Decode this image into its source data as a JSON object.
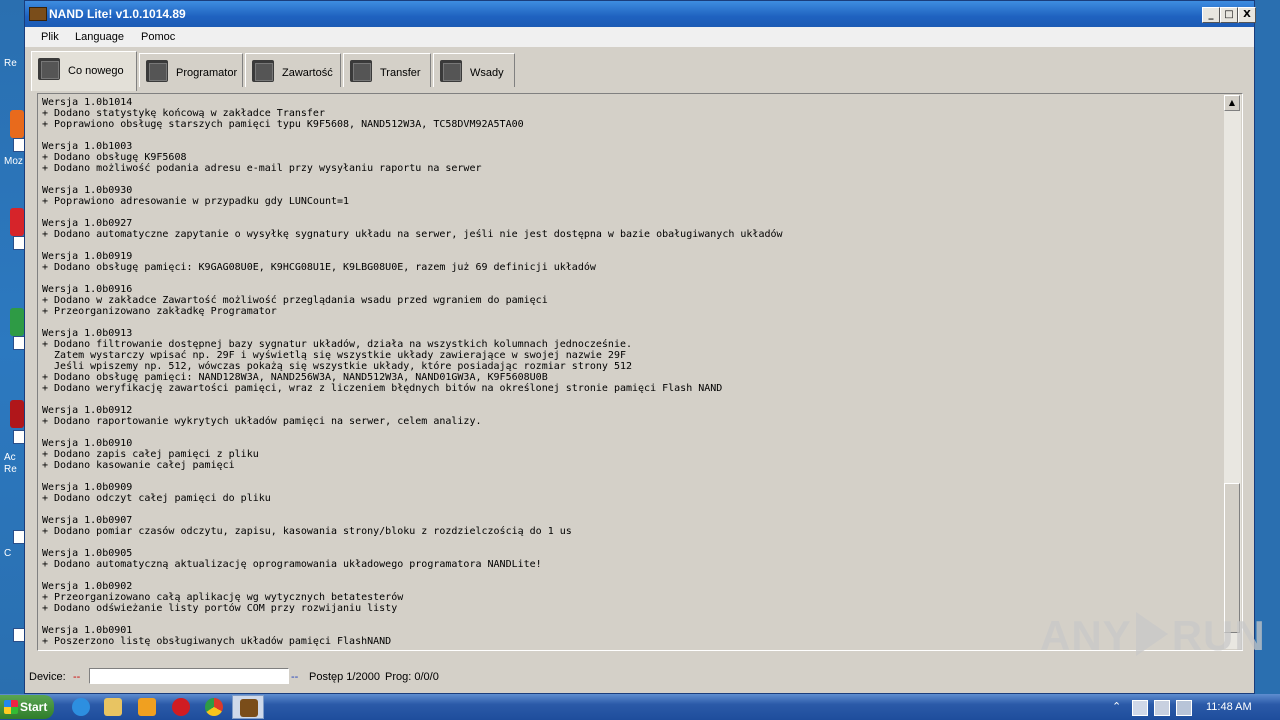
{
  "window": {
    "title": "NAND Lite! v1.0.1014.89",
    "controls": {
      "minimize": "_",
      "maximize": "□",
      "close": "X"
    }
  },
  "menu": {
    "items": [
      "Plik",
      "Language",
      "Pomoc"
    ]
  },
  "tabs": [
    {
      "label": "Co nowego",
      "active": true
    },
    {
      "label": "Programator"
    },
    {
      "label": "Zawartość"
    },
    {
      "label": "Transfer"
    },
    {
      "label": "Wsady"
    }
  ],
  "changelog": [
    "Wersja 1.0b1014",
    "+ Dodano statystykę końcową w zakładce Transfer",
    "+ Poprawiono obsługę starszych pamięci typu K9F5608, NAND512W3A, TC58DVM92A5TA00",
    "",
    "Wersja 1.0b1003",
    "+ Dodano obsługę K9F5608",
    "+ Dodano możliwość podania adresu e-mail przy wysyłaniu raportu na serwer",
    "",
    "Wersja 1.0b0930",
    "+ Poprawiono adresowanie w przypadku gdy LUNCount=1",
    "",
    "Wersja 1.0b0927",
    "+ Dodano automatyczne zapytanie o wysyłkę sygnatury układu na serwer, jeśli nie jest dostępna w bazie obaługiwanych układów",
    "",
    "Wersja 1.0b0919",
    "+ Dodano obsługę pamięci: K9GAG08U0E, K9HCG08U1E, K9LBG08U0E, razem już 69 definicji układów",
    "",
    "Wersja 1.0b0916",
    "+ Dodano w zakładce Zawartość możliwość przeglądania wsadu przed wgraniem do pamięci",
    "+ Przeorganizowano zakładkę Programator",
    "",
    "Wersja 1.0b0913",
    "+ Dodano filtrowanie dostępnej bazy sygnatur układów, działa na wszystkich kolumnach jednocześnie.",
    "  Zatem wystarczy wpisać np. 29F i wyświetlą się wszystkie układy zawierające w swojej nazwie 29F",
    "  Jeśli wpiszemy np. 512, wówczas pokażą się wszystkie układy, które posiadając rozmiar strony 512",
    "+ Dodano obsługę pamięci: NAND128W3A, NAND256W3A, NAND512W3A, NAND01GW3A, K9F5608U0B",
    "+ Dodano weryfikację zawartości pamięci, wraz z liczeniem błędnych bitów na określonej stronie pamięci Flash NAND",
    "",
    "Wersja 1.0b0912",
    "+ Dodano raportowanie wykrytych układów pamięci na serwer, celem analizy.",
    "",
    "Wersja 1.0b0910",
    "+ Dodano zapis całej pamięci z pliku",
    "+ Dodano kasowanie całej pamięci",
    "",
    "Wersja 1.0b0909",
    "+ Dodano odczyt całej pamięci do pliku",
    "",
    "Wersja 1.0b0907",
    "+ Dodano pomiar czasów odczytu, zapisu, kasowania strony/bloku z rozdzielczością do 1 us",
    "",
    "Wersja 1.0b0905",
    "+ Dodano automatyczną aktualizację oprogramowania układowego programatora NANDLite!",
    "",
    "Wersja 1.0b0902",
    "+ Przeorganizowano całą aplikację wg wytycznych betatesterów",
    "+ Dodano odświeżanie listy portów COM przy rozwijaniu listy",
    "",
    "Wersja 1.0b0901",
    "+ Poszerzono listę obsługiwanych układów pamięci FlashNAND"
  ],
  "status": {
    "device_label": "Device:",
    "device_value": "--",
    "sep": "--",
    "progress_text": "Postęp 1/2000",
    "prog_text": "Prog: 0/0/0"
  },
  "watermark": {
    "left": "ANY",
    "right": "RUN"
  },
  "desktop": {
    "labels": [
      "Re",
      "Moz",
      "Ac",
      "Re",
      "C"
    ]
  },
  "taskbar": {
    "start_label": "Start",
    "clock": "11:48 AM",
    "icons": [
      "ie-icon",
      "explorer-icon",
      "media-icon",
      "opera-icon",
      "chrome-icon",
      "nand-app-icon"
    ]
  },
  "colors": {
    "titlebar": "#1f62c0",
    "window_bg": "#d4d0c8",
    "taskbar": "#2b5aa8"
  }
}
